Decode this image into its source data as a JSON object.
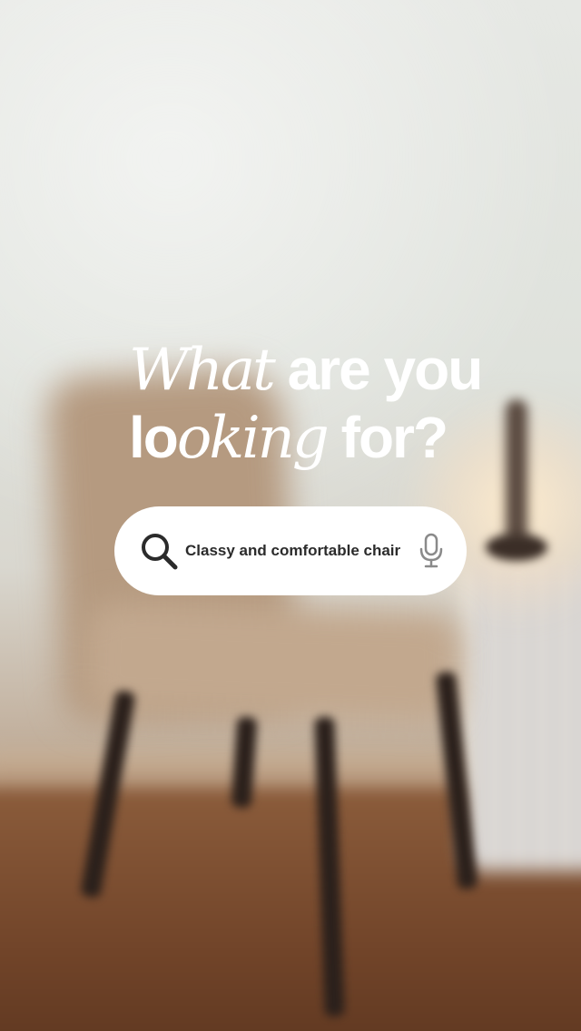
{
  "headline": {
    "line1_part1": "What",
    "line1_part2": " are you",
    "line2_part1": "lo",
    "line2_part2": "oking",
    "line2_part3": " for?"
  },
  "search": {
    "query": "Classy and comfortable chair",
    "search_icon": "search-icon",
    "mic_icon": "microphone-icon"
  },
  "colors": {
    "headline_text": "#ffffff",
    "pill_background": "#ffffff",
    "query_text": "#2b2b2b",
    "mic_icon": "#8a8a8a"
  }
}
